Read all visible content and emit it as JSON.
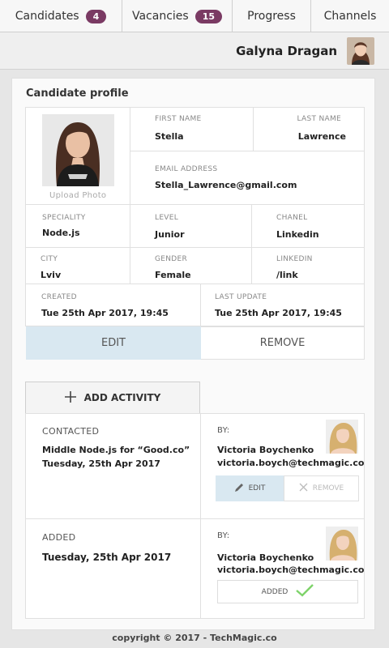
{
  "nav": {
    "tabs": [
      {
        "label": "Candidates",
        "badge": "4"
      },
      {
        "label": "Vacancies",
        "badge": "15"
      },
      {
        "label": "Progress"
      },
      {
        "label": "Channels"
      }
    ]
  },
  "user": {
    "name": "Galyna Dragan"
  },
  "profile": {
    "title": "Candidate profile",
    "upload_label": "Upload Photo",
    "first_name_label": "FIRST NAME",
    "first_name": "Stella",
    "last_name_label": "LAST NAME",
    "last_name": "Lawrence",
    "email_label": "EMAIL ADDRESS",
    "email": "Stella_Lawrence@gmail.com",
    "speciality_label": "SPECIALITY",
    "speciality": "Node.js",
    "level_label": "LEVEL",
    "level": "Junior",
    "chanel_label": "CHANEL",
    "chanel": "Linkedin",
    "city_label": "CITY",
    "city": "Lviv",
    "gender_label": "GENDER",
    "gender": "Female",
    "linkedin_label": "LINKEDIN",
    "linkedin": "/link",
    "created_label": "CREATED",
    "created": "Tue 25th Apr 2017, 19:45",
    "updated_label": "LAST UPDATE",
    "updated": "Tue 25th Apr 2017, 19:45",
    "edit_label": "EDIT",
    "remove_label": "REMOVE"
  },
  "activity": {
    "add_label": "ADD ACTIVITY",
    "items": [
      {
        "status": "CONTACTED",
        "line1": "Middle Node.js for “Good.co”",
        "line2": "Tuesday, 25th Apr 2017",
        "by_label": "BY:",
        "by_name": "Victoria Boychenko",
        "by_email": "victoria.boych@techmagic.co",
        "edit_label": "EDIT",
        "remove_label": "REMOVE"
      },
      {
        "status": "ADDED",
        "line1": "Tuesday, 25th Apr 2017",
        "by_label": "BY:",
        "by_name": "Victoria Boychenko",
        "by_email": "victoria.boych@techmagic.co",
        "added_label": "ADDED"
      }
    ]
  },
  "footer": {
    "text": "copyright © 2017 - TechMagic.co"
  },
  "colors": {
    "accent": "#7a3a63",
    "edit_bg": "#d9e8f1",
    "check": "#7ed36a"
  }
}
